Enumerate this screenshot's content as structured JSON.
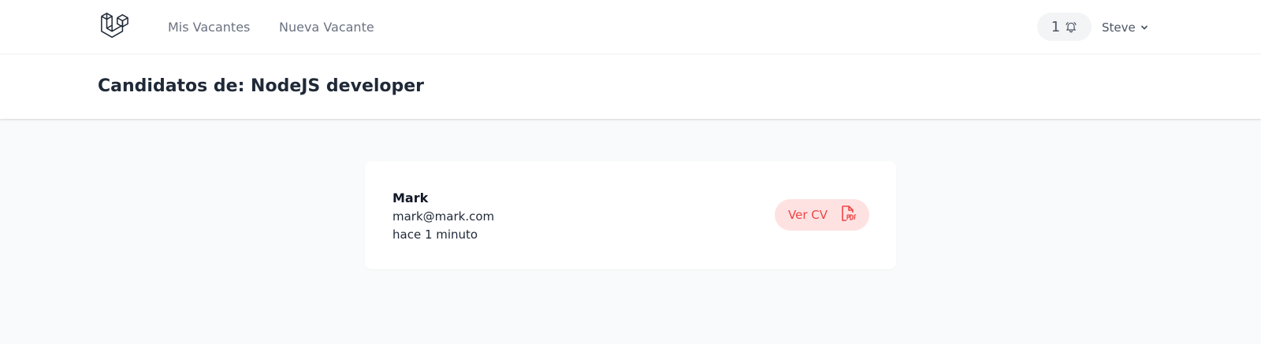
{
  "nav": {
    "logo_icon": "laravel-logo-icon",
    "links": [
      {
        "label": "Mis Vacantes"
      },
      {
        "label": "Nueva Vacante"
      }
    ],
    "notifications": {
      "count": "1",
      "icon": "bell-icon"
    },
    "user": {
      "name": "Steve",
      "icon": "chevron-down-icon"
    }
  },
  "header": {
    "title": "Candidatos de: NodeJS developer"
  },
  "candidates": [
    {
      "name": "Mark",
      "email": "mark@mark.com",
      "time": "hace 1 minuto",
      "cv_label": "Ver CV",
      "cv_icon": "pdf-file-icon"
    }
  ],
  "colors": {
    "cv_button_bg": "#fee2e2",
    "cv_button_text": "#ef4444",
    "page_bg": "#f9fafb"
  }
}
